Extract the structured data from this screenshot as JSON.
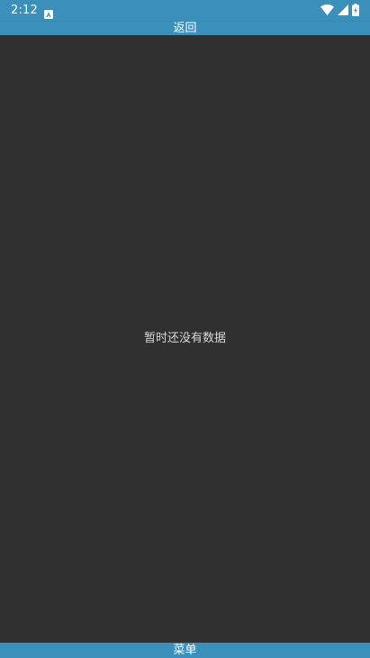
{
  "status_bar": {
    "time": "2:12",
    "notification_icon": "a-letter-icon",
    "wifi_icon": "wifi-icon",
    "signal_icon": "cell-signal-icon",
    "battery_icon": "battery-icon"
  },
  "top_bar": {
    "back_label": "返回"
  },
  "content": {
    "empty_message": "暂时还没有数据"
  },
  "bottom_bar": {
    "menu_label": "菜单"
  },
  "colors": {
    "accent": "#3a8fbb",
    "background": "#303030",
    "text_primary": "#ffffff",
    "text_secondary": "#d8d8d8"
  }
}
